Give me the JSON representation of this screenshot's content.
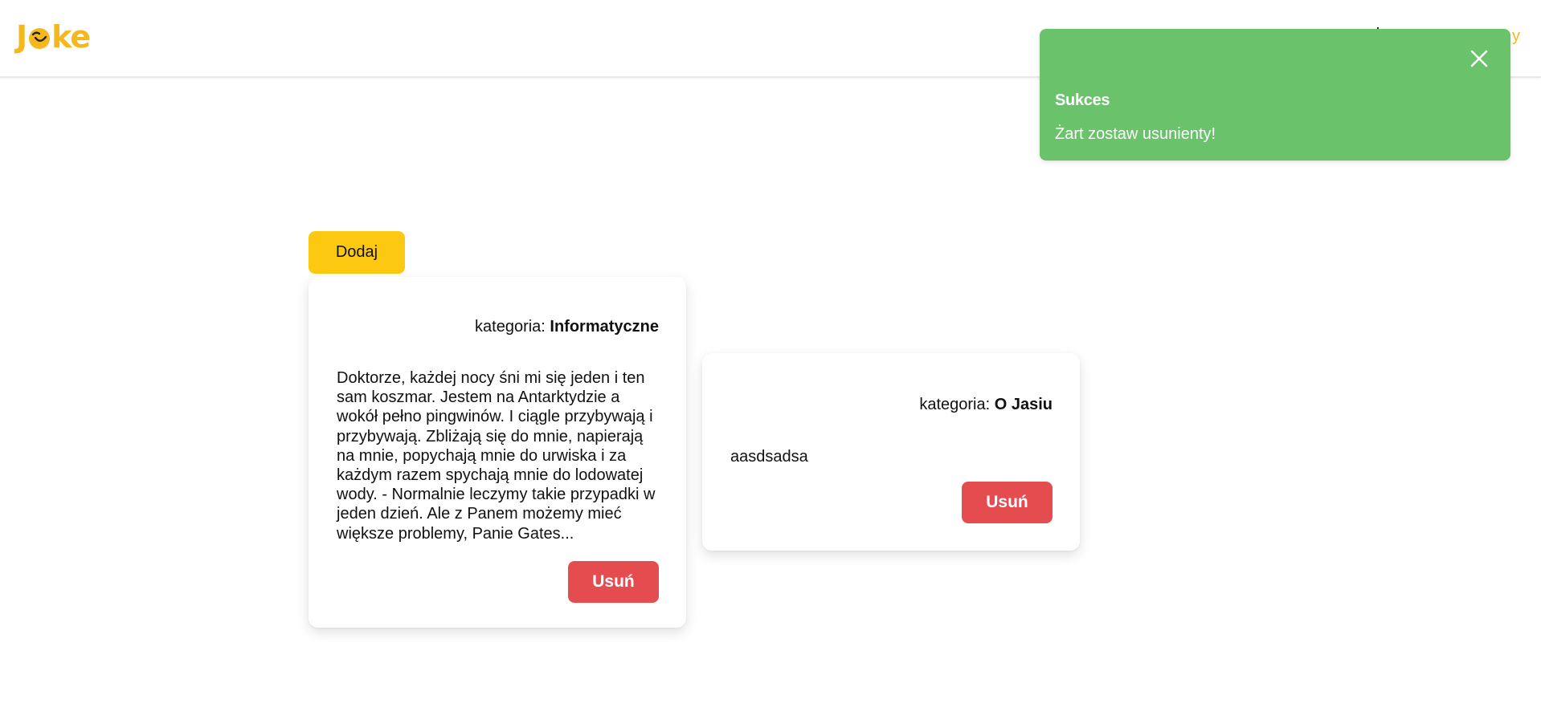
{
  "header": {
    "logo_text_left": "J",
    "logo_text_right": "ke",
    "logo_icon": "smile-face-icon",
    "nav_right_text": "y"
  },
  "toast": {
    "title": "Sukces",
    "message": "Żart zostaw usunienty!",
    "close_icon": "close-icon",
    "color": "#6ac26b"
  },
  "actions": {
    "add_label": "Dodaj"
  },
  "jokes": [
    {
      "category_label": "kategoria:",
      "category": "Informatyczne",
      "text": "Doktorze, każdej nocy śni mi się jeden i ten sam koszmar. Jestem na Antarktydzie a wokół pełno pingwinów. I ciągle przybywają i przybywają. Zbliżają się do mnie, napierają na mnie, popychają mnie do urwiska i za każdym razem spychają mnie do lodowatej wody. - Normalnie leczymy takie przypadki w jeden dzień. Ale z Panem możemy mieć większe problemy, Panie Gates...",
      "delete_label": "Usuń"
    },
    {
      "category_label": "kategoria:",
      "category": "O Jasiu",
      "text": "aasdsadsa",
      "delete_label": "Usuń"
    }
  ],
  "colors": {
    "brand_yellow": "#fdc812",
    "logo_yellow": "#f4b81c",
    "danger": "#e44c4f",
    "success": "#6ac26b"
  }
}
